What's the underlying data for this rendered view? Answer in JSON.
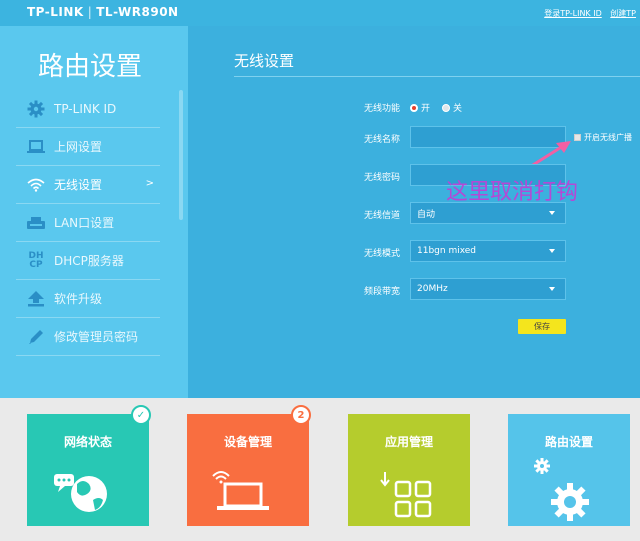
{
  "header": {
    "brand": "TP-LINK",
    "model": "TL-WR890N",
    "links": [
      "登录TP-LINK ID",
      "创建TP"
    ]
  },
  "sidebar": {
    "title": "路由设置",
    "items": [
      {
        "label": "TP-LINK ID",
        "icon": "gear-icon"
      },
      {
        "label": "上网设置",
        "icon": "laptop-icon"
      },
      {
        "label": "无线设置",
        "icon": "wifi-icon",
        "active": true,
        "chevron": ">"
      },
      {
        "label": "LAN口设置",
        "icon": "router-icon"
      },
      {
        "label": "DHCP服务器",
        "icon": "dhcp-icon",
        "icon_text": [
          "DH",
          "CP"
        ]
      },
      {
        "label": "软件升级",
        "icon": "upload-icon"
      },
      {
        "label": "修改管理员密码",
        "icon": "pencil-icon"
      }
    ]
  },
  "main": {
    "title": "无线设置",
    "fields": {
      "wireless_func": {
        "label": "无线功能",
        "on": "开",
        "off": "关",
        "selected": "开"
      },
      "ssid": {
        "label": "无线名称",
        "value": ""
      },
      "broadcast": {
        "label": "开启无线广播",
        "checked": false
      },
      "password": {
        "label": "无线密码",
        "value": ""
      },
      "channel": {
        "label": "无线信道",
        "value": "自动"
      },
      "mode": {
        "label": "无线模式",
        "value": "11bgn mixed"
      },
      "bandwidth": {
        "label": "频段带宽",
        "value": "20MHz"
      }
    },
    "save_label": "保存",
    "annotation": "这里取消打钩"
  },
  "tiles": [
    {
      "label": "网络状态",
      "color": "#28c8b4",
      "icon": "globe-icon",
      "badge": "check"
    },
    {
      "label": "设备管理",
      "color": "#f96e40",
      "icon": "laptop-wifi-icon",
      "badge": "2"
    },
    {
      "label": "应用管理",
      "color": "#b5cc2d",
      "icon": "apps-icon"
    },
    {
      "label": "路由设置",
      "color": "#55c4ea",
      "icon": "gears-icon"
    }
  ],
  "colors": {
    "accent": "#3cb0de",
    "annotation": "#b449d6",
    "save": "#f4e51d"
  }
}
